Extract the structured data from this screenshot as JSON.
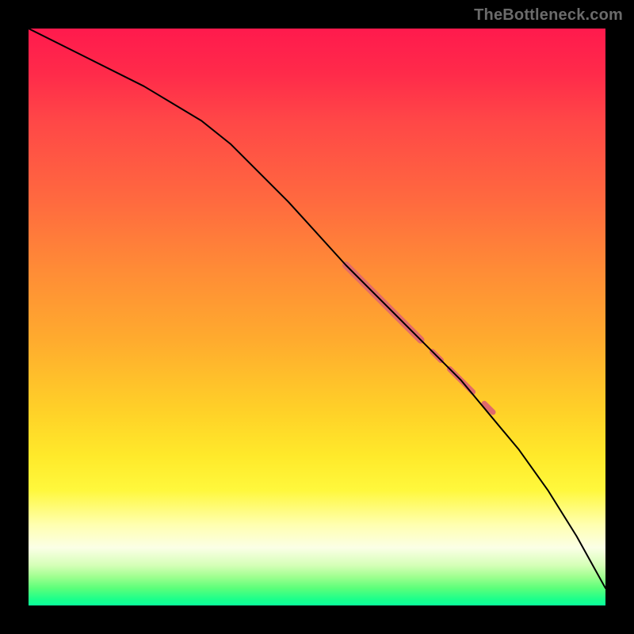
{
  "watermark": "TheBottleneck.com",
  "chart_data": {
    "type": "line",
    "title": "",
    "xlabel": "",
    "ylabel": "",
    "xlim": [
      0,
      100
    ],
    "ylim": [
      0,
      100
    ],
    "grid": false,
    "legend": false,
    "series": [
      {
        "name": "curve",
        "color": "#000000",
        "x": [
          0,
          10,
          20,
          30,
          35,
          45,
          55,
          60,
          65,
          70,
          75,
          80,
          85,
          90,
          95,
          100
        ],
        "y": [
          100,
          95,
          90,
          84,
          80,
          70,
          59,
          54,
          49,
          44,
          39,
          33,
          27,
          20,
          12,
          3
        ]
      }
    ],
    "highlight_segments": [
      {
        "x0": 55,
        "y0": 59,
        "x1": 68,
        "y1": 46,
        "width": 9
      },
      {
        "x0": 70,
        "y0": 44,
        "x1": 71.5,
        "y1": 42.5,
        "width": 7
      },
      {
        "x0": 73,
        "y0": 41,
        "x1": 77,
        "y1": 37,
        "width": 7
      },
      {
        "x0": 79,
        "y0": 35,
        "x1": 80.5,
        "y1": 33.5,
        "width": 7
      }
    ],
    "highlight_color": "#e06a6a",
    "background_gradient": {
      "stops": [
        {
          "pos": 0.0,
          "color": "#ff1a4d"
        },
        {
          "pos": 0.3,
          "color": "#ff6a3f"
        },
        {
          "pos": 0.54,
          "color": "#ffab2e"
        },
        {
          "pos": 0.74,
          "color": "#ffe92a"
        },
        {
          "pos": 0.9,
          "color": "#fbffe6"
        },
        {
          "pos": 1.0,
          "color": "#0aff9c"
        }
      ]
    }
  }
}
